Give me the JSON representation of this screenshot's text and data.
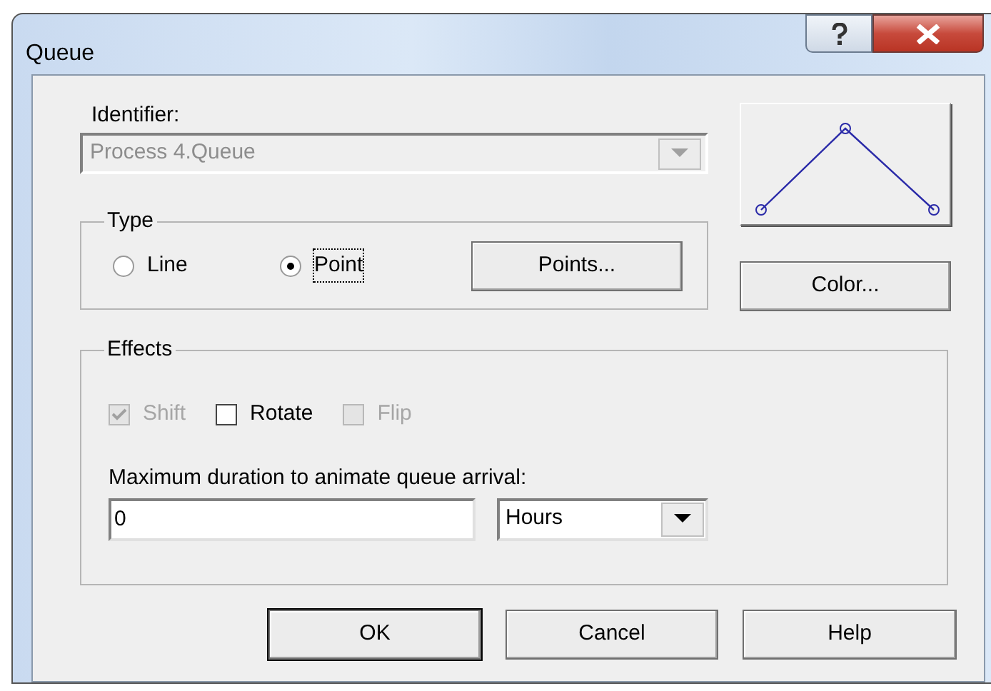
{
  "window": {
    "title": "Queue"
  },
  "identifier": {
    "label": "Identifier:",
    "value": "Process 4.Queue",
    "disabled": true
  },
  "type": {
    "label": "Type",
    "options": [
      {
        "label": "Line",
        "selected": false
      },
      {
        "label": "Point",
        "selected": true
      }
    ],
    "points_button": "Points..."
  },
  "color_button": "Color...",
  "effects": {
    "label": "Effects",
    "checkboxes": [
      {
        "label": "Shift",
        "checked": true,
        "disabled": true
      },
      {
        "label": "Rotate",
        "checked": false,
        "disabled": false
      },
      {
        "label": "Flip",
        "checked": false,
        "disabled": true
      }
    ],
    "duration_label": "Maximum duration to animate queue arrival:",
    "duration_value": "0",
    "unit": "Hours"
  },
  "buttons": [
    "OK",
    "Cancel",
    "Help"
  ]
}
